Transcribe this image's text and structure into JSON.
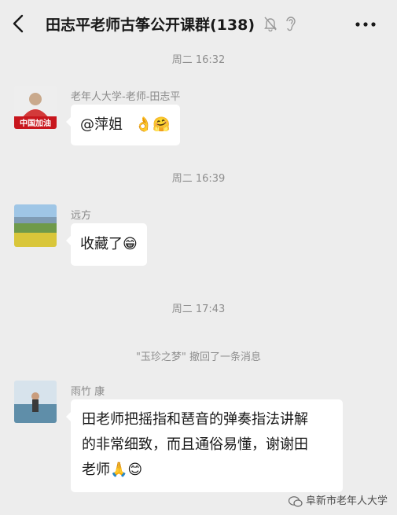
{
  "header": {
    "title": "田志平老师古筝公开课群(138)",
    "back_icon": "chevron-left-icon",
    "mute_icon": "bell-muted-icon",
    "ear_icon": "earpiece-icon",
    "more_icon": "more-dots-icon"
  },
  "messages": [
    {
      "time": "周二 16:32",
      "sender": "老年人大学-老师-田志平",
      "text": "@萍姐",
      "emojis": "👌🤗",
      "avatar_text": "中国加油"
    },
    {
      "time": "周二 16:39",
      "sender": "远方",
      "text": "收藏了",
      "emojis": "😁"
    },
    {
      "time": "周二 17:43"
    },
    {
      "recall": "\"玉珍之梦\" 撤回了一条消息"
    },
    {
      "sender": "雨竹 康",
      "lines": [
        "田老师把摇指和琶音的弹奏指法讲解",
        "的非常细致，而且通俗易懂，谢谢田",
        "老师"
      ],
      "emojis": "🙏😊"
    }
  ],
  "watermark": {
    "text": "阜新市老年人大学",
    "icon": "wechat-icon"
  },
  "colors": {
    "background": "#ededed",
    "bubble": "#ffffff",
    "timestamp": "#8f8f8f"
  }
}
